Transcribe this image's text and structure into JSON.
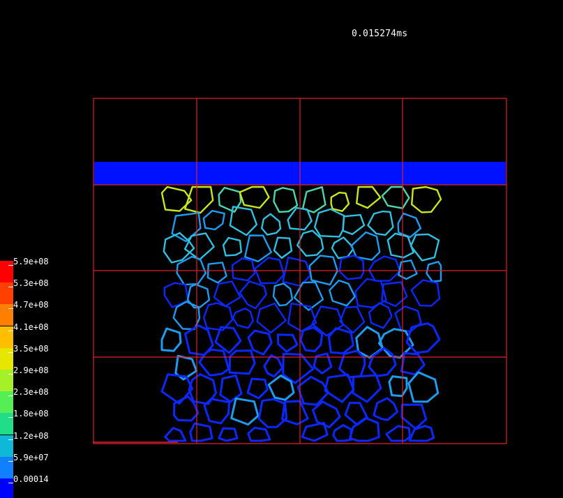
{
  "header": {
    "time_label": "0.015274ms"
  },
  "legend": {
    "entries": [
      {
        "label": "5.9e+08",
        "color": "#ff0000"
      },
      {
        "label": "5.3e+08",
        "color": "#ff4000"
      },
      {
        "label": "4.7e+08",
        "color": "#ff8000"
      },
      {
        "label": "4.1e+08",
        "color": "#ffbf00"
      },
      {
        "label": "3.5e+08",
        "color": "#e6e600"
      },
      {
        "label": "2.9e+08",
        "color": "#a6f02a"
      },
      {
        "label": "2.3e+08",
        "color": "#55ee55"
      },
      {
        "label": "1.8e+08",
        "color": "#22dd88"
      },
      {
        "label": "1.2e+08",
        "color": "#10b8d8"
      },
      {
        "label": "5.9e+07",
        "color": "#1080ff"
      },
      {
        "label": "0.00014",
        "color": "#0000ff"
      }
    ]
  },
  "scene": {
    "grid_color": "#e0202a",
    "plate_color": "#0011ff",
    "low_stress_color": "#0a28ff",
    "high_stress_colors": [
      "#c8e81a",
      "#4ad8b0",
      "#30c0e0",
      "#1e9cf0"
    ]
  }
}
